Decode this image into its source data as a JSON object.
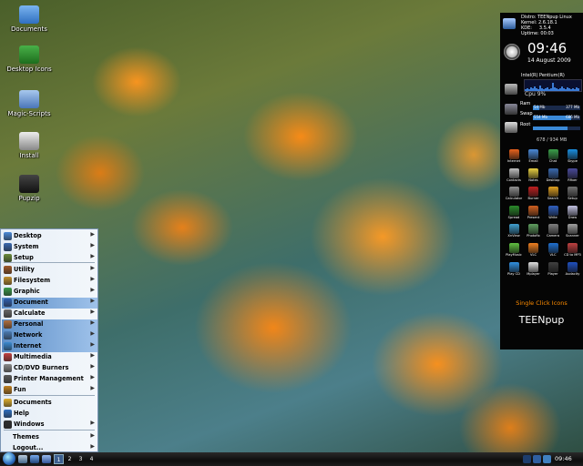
{
  "desktop_icons": [
    {
      "name": "documents-desktop-icon",
      "label": "Documents",
      "color": "#3f7fcf"
    },
    {
      "name": "desktop-icons-desktop-icon",
      "label": "Desktop Icons",
      "color": "#2e8b2e"
    },
    {
      "name": "magic-scripts-desktop-icon",
      "label": "Magic-Scripts",
      "color": "#5a86c0"
    },
    {
      "name": "install-desktop-icon",
      "label": "Install",
      "color": "#d8d8d8"
    },
    {
      "name": "pupzip-desktop-icon",
      "label": "Pupzip",
      "color": "#1a1a1a"
    }
  ],
  "conky": {
    "info": "Distro: TEENpup Linux\nKernel: 2.6.18.1\nKDE:     3.5.4\nUptime: 00:03",
    "time": "09:46",
    "date": "14 August 2009",
    "cpu_name": "Intel(R) Pentium(R)",
    "cpu_label": "Cpu",
    "cpu_percent": "9%",
    "ram_label": "Ram",
    "ram_used": "54 Mb",
    "ram_total": "377 Mb",
    "ram_fraction": 0.14,
    "swap_label": "Swap",
    "swap_used": "554 Mb",
    "swap_total": "686 Mb",
    "swap_fraction": 0.81,
    "root_label": "Root",
    "root_value": "678 / 934 MB",
    "root_fraction": 0.73,
    "apps": [
      {
        "label": "Internet",
        "color": "#e8621c"
      },
      {
        "label": "Email",
        "color": "#4a8ad8"
      },
      {
        "label": "Chat",
        "color": "#3aa04a"
      },
      {
        "label": "Skype",
        "color": "#1a8fe0"
      },
      {
        "label": "Contacts",
        "color": "#c0c0c0"
      },
      {
        "label": "Notes",
        "color": "#e8d040"
      },
      {
        "label": "Desktop",
        "color": "#3a6ab0"
      },
      {
        "label": "Rfixer",
        "color": "#4a4a9a"
      },
      {
        "label": "Calculator",
        "color": "#909090"
      },
      {
        "label": "Burner",
        "color": "#c02020"
      },
      {
        "label": "Search",
        "color": "#e0a020"
      },
      {
        "label": "Setup",
        "color": "#707070"
      },
      {
        "label": "Spread",
        "color": "#2a8a2a"
      },
      {
        "label": "Present",
        "color": "#d06020"
      },
      {
        "label": "Write",
        "color": "#3060c0"
      },
      {
        "label": "Draw",
        "color": "#c0c0e0"
      },
      {
        "label": "XnView",
        "color": "#40a0d0"
      },
      {
        "label": "Photofix",
        "color": "#60a060"
      },
      {
        "label": "Camera",
        "color": "#808080"
      },
      {
        "label": "Scanner",
        "color": "#a0a0a0"
      },
      {
        "label": "PlayMusic",
        "color": "#60c040"
      },
      {
        "label": "VLC",
        "color": "#f08020"
      },
      {
        "label": "VLC",
        "color": "#2070d0"
      },
      {
        "label": "CD to MP3",
        "color": "#c04040"
      },
      {
        "label": "Play CD",
        "color": "#3090e0"
      },
      {
        "label": "Mplayer",
        "color": "#e0e0e0"
      },
      {
        "label": "Player",
        "color": "#404040"
      },
      {
        "label": "Audacity",
        "color": "#2050c0"
      }
    ],
    "single_click": "Single Click Icons",
    "brand": "TEENpup"
  },
  "menu": {
    "items": [
      {
        "label": "Desktop",
        "submenu": true,
        "color": "#4a8ad8"
      },
      {
        "label": "System",
        "submenu": true,
        "color": "#3a6ab0"
      },
      {
        "label": "Setup",
        "submenu": true,
        "color": "#6a8a3a"
      },
      {
        "label": "Utility",
        "submenu": true,
        "color": "#a05a2a"
      },
      {
        "label": "Filesystem",
        "submenu": true,
        "color": "#c09030"
      },
      {
        "label": "Graphic",
        "submenu": true,
        "color": "#3a9a4a"
      },
      {
        "label": "Document",
        "submenu": true,
        "color": "#3060b0"
      },
      {
        "label": "Calculate",
        "submenu": true,
        "color": "#6a6a6a"
      },
      {
        "label": "Personal",
        "submenu": true,
        "color": "#b07040"
      },
      {
        "label": "Network",
        "submenu": true,
        "color": "#4a7ab0"
      },
      {
        "label": "Internet",
        "submenu": true,
        "color": "#3a8ad0"
      },
      {
        "label": "Multimedia",
        "submenu": true,
        "color": "#c04040"
      },
      {
        "label": "CD/DVD Burners",
        "submenu": true,
        "color": "#8a8a8a"
      },
      {
        "label": "Printer Management",
        "submenu": true,
        "color": "#5a5a5a"
      },
      {
        "label": "Fun",
        "submenu": true,
        "color": "#c08020"
      },
      {
        "label": "Documents",
        "submenu": false,
        "color": "#e0b030"
      },
      {
        "label": "Help",
        "submenu": false,
        "color": "#3070c0"
      },
      {
        "label": "Windows",
        "submenu": true,
        "color": "#303030"
      },
      {
        "label": "Themes",
        "submenu": true,
        "color": ""
      },
      {
        "label": "Logout...",
        "submenu": true,
        "color": ""
      }
    ],
    "highlighted": [
      "Document",
      "Personal",
      "Network",
      "Internet"
    ]
  },
  "taskbar": {
    "workspaces": [
      "1",
      "2",
      "3",
      "4"
    ],
    "active_workspace": "1",
    "time": "09:46"
  }
}
